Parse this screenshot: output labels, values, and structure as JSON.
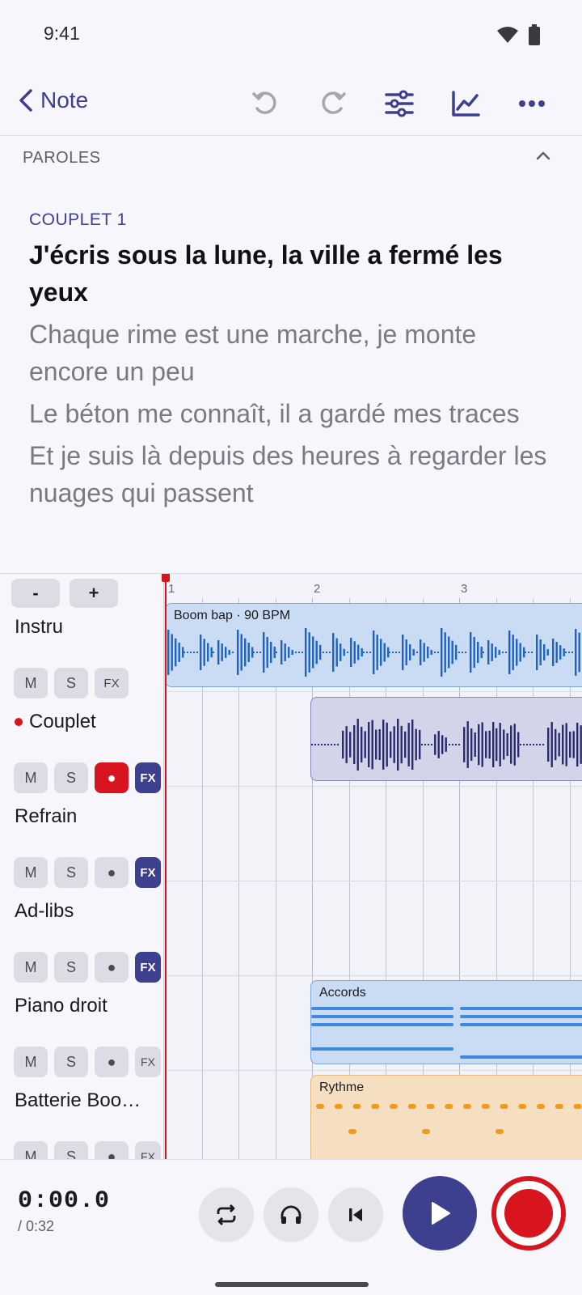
{
  "status": {
    "time": "9:41"
  },
  "topbar": {
    "back_label": "Note"
  },
  "lyrics": {
    "section_title": "PAROLES",
    "verse_label": "COUPLET 1",
    "lines": [
      "J'écris sous la lune, la ville a fermé les yeux",
      "Chaque rime est une marche, je monte encore un peu",
      "Le béton me connaît, il a gardé mes traces",
      "Et je suis là depuis des heures à regarder les nuages qui passent"
    ],
    "active_line": 0
  },
  "zoom": {
    "minus": "-",
    "plus": "+"
  },
  "timeline": {
    "bars": [
      "1",
      "2",
      "3"
    ]
  },
  "tracks": [
    {
      "name": "Instru",
      "armed": false,
      "buttons": [
        "M",
        "S",
        "FX"
      ],
      "fx_on": false
    },
    {
      "name": "Couplet",
      "armed": true,
      "buttons": [
        "M",
        "S",
        "●",
        "FX"
      ],
      "fx_on": true
    },
    {
      "name": "Refrain",
      "armed": false,
      "buttons": [
        "M",
        "S",
        "●",
        "FX"
      ],
      "fx_on": true
    },
    {
      "name": "Ad-libs",
      "armed": false,
      "buttons": [
        "M",
        "S",
        "●",
        "FX"
      ],
      "fx_on": true
    },
    {
      "name": "Piano droit",
      "armed": false,
      "buttons": [
        "M",
        "S",
        "●",
        "FX"
      ],
      "fx_on": false
    },
    {
      "name": "Batterie Boo…",
      "armed": false,
      "buttons": [
        "M",
        "S",
        "●",
        "FX"
      ],
      "fx_on": false
    }
  ],
  "clips": {
    "instru": "Boom bap · 90 BPM",
    "piano": "Accords",
    "drums": "Rythme"
  },
  "transport": {
    "current": "0:00.0",
    "total": "/ 0:32"
  },
  "colors": {
    "accent": "#3d3f8f",
    "record": "#d8141f",
    "audio_clip": "#c9dcf4",
    "vocal_clip": "#d3d3ea",
    "drum_clip": "#f6dfc0"
  }
}
